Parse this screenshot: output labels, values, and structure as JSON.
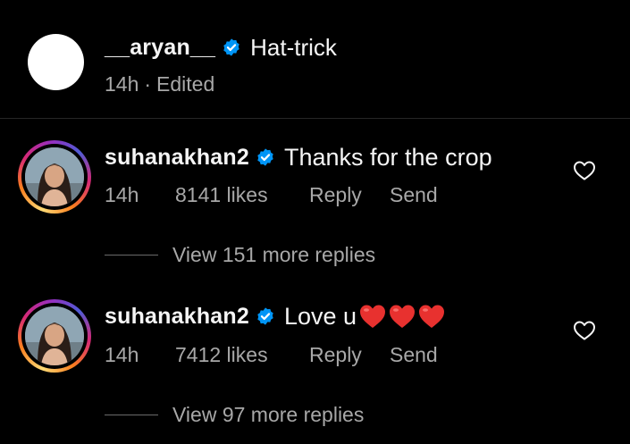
{
  "post": {
    "username": "__aryan__",
    "verified": true,
    "caption": "Hat-trick",
    "time": "14h",
    "separator": "·",
    "edited": "Edited"
  },
  "comments": [
    {
      "username": "suhanakhan2",
      "verified": true,
      "text": "Thanks for the crop",
      "time": "14h",
      "likes": "8141 likes",
      "reply_label": "Reply",
      "send_label": "Send",
      "view_replies": "View 151 more replies",
      "liked": false
    },
    {
      "username": "suhanakhan2",
      "verified": true,
      "text": "Love u",
      "emoji": [
        "red-heart",
        "red-heart",
        "red-heart"
      ],
      "time": "14h",
      "likes": "7412 likes",
      "reply_label": "Reply",
      "send_label": "Send",
      "view_replies": "View 97 more replies",
      "liked": false
    }
  ],
  "colors": {
    "background": "#000000",
    "text_primary": "#f5f5f5",
    "text_secondary": "#a8a8a8",
    "verified_blue": "#0095f6",
    "heart_red": "#e8312f",
    "divider": "#262626"
  }
}
